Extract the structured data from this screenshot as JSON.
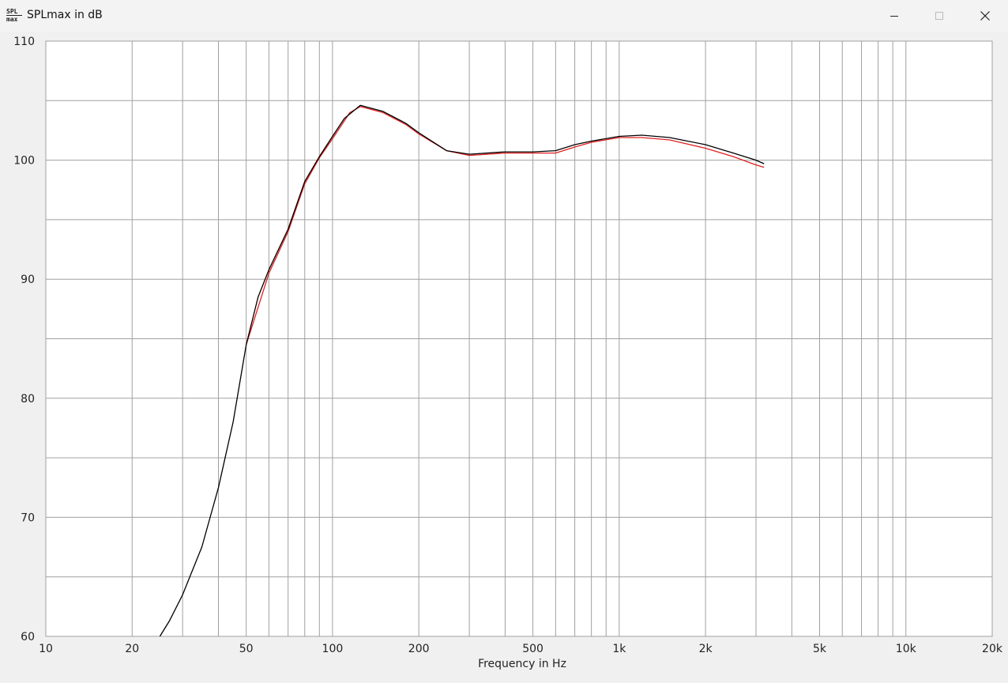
{
  "window": {
    "title": "SPLmax in dB",
    "icon_top": "SPL",
    "icon_bottom": "max",
    "minimize_icon": "minimize-icon",
    "maximize_icon": "maximize-icon",
    "close_icon": "close-icon"
  },
  "chart_data": {
    "type": "line",
    "title": "SPLmax in dB",
    "xlabel": "Frequency in Hz",
    "ylabel": "",
    "xscale": "log",
    "xlim": [
      10,
      20000
    ],
    "ylim": [
      60,
      110
    ],
    "grid": true,
    "xticks": [
      10,
      20,
      50,
      100,
      200,
      500,
      1000,
      2000,
      5000,
      10000,
      20000
    ],
    "xtick_labels": [
      "10",
      "20",
      "50",
      "100",
      "200",
      "500",
      "1k",
      "2k",
      "5k",
      "10k",
      "20k"
    ],
    "yticks": [
      60,
      70,
      80,
      90,
      100,
      110
    ],
    "ytick_labels": [
      "60",
      "70",
      "80",
      "90",
      "100",
      "110"
    ],
    "series": [
      {
        "color": "#e02020",
        "points": [
          [
            50,
            84.5
          ],
          [
            60,
            90.5
          ],
          [
            70,
            94
          ],
          [
            80,
            98
          ],
          [
            90,
            100.2
          ],
          [
            100,
            101.8
          ],
          [
            115,
            104
          ],
          [
            125,
            104.5
          ],
          [
            150,
            104
          ],
          [
            180,
            103
          ],
          [
            200,
            102.2
          ],
          [
            250,
            100.8
          ],
          [
            300,
            100.4
          ],
          [
            400,
            100.6
          ],
          [
            500,
            100.6
          ],
          [
            600,
            100.6
          ],
          [
            700,
            101.1
          ],
          [
            800,
            101.5
          ],
          [
            1000,
            101.9
          ],
          [
            1200,
            101.9
          ],
          [
            1500,
            101.7
          ],
          [
            2000,
            101
          ],
          [
            2500,
            100.3
          ],
          [
            3000,
            99.6
          ],
          [
            3200,
            99.4
          ]
        ]
      },
      {
        "color": "#000000",
        "points": [
          [
            25,
            60
          ],
          [
            27,
            61.3
          ],
          [
            30,
            63.5
          ],
          [
            35,
            67.5
          ],
          [
            40,
            72.5
          ],
          [
            45,
            78
          ],
          [
            50,
            84.5
          ],
          [
            55,
            88.5
          ],
          [
            60,
            90.8
          ],
          [
            70,
            94.2
          ],
          [
            80,
            98.2
          ],
          [
            90,
            100.3
          ],
          [
            100,
            102
          ],
          [
            110,
            103.5
          ],
          [
            125,
            104.6
          ],
          [
            150,
            104.1
          ],
          [
            180,
            103.1
          ],
          [
            200,
            102.3
          ],
          [
            250,
            100.8
          ],
          [
            300,
            100.5
          ],
          [
            400,
            100.7
          ],
          [
            500,
            100.7
          ],
          [
            600,
            100.8
          ],
          [
            700,
            101.3
          ],
          [
            800,
            101.6
          ],
          [
            1000,
            102
          ],
          [
            1200,
            102.1
          ],
          [
            1500,
            101.9
          ],
          [
            2000,
            101.3
          ],
          [
            2500,
            100.6
          ],
          [
            3000,
            100
          ],
          [
            3200,
            99.7
          ]
        ]
      }
    ]
  }
}
